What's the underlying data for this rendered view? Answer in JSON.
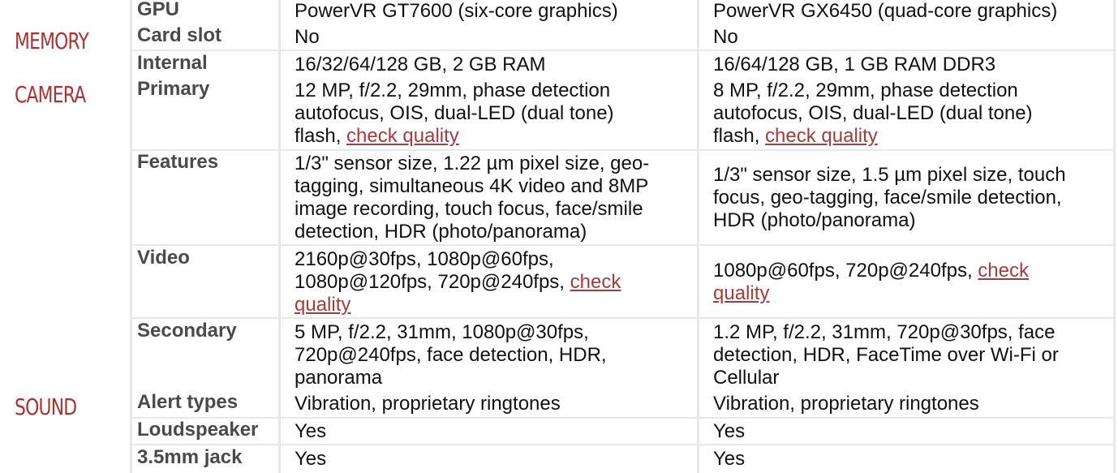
{
  "sections": {
    "memory": "MEMORY",
    "camera": "CAMERA",
    "sound": "SOUND"
  },
  "rows": {
    "gpu": {
      "label": "GPU",
      "left": "PowerVR GT7600 (six-core graphics)",
      "right": "PowerVR GX6450 (quad-core graphics)"
    },
    "card_slot": {
      "label": "Card slot",
      "left": "No",
      "right": "No"
    },
    "internal": {
      "label": "Internal",
      "left": "16/32/64/128 GB, 2 GB RAM",
      "right": "16/64/128 GB, 1 GB RAM DDR3"
    },
    "primary": {
      "label": "Primary",
      "left_lines": [
        "12 MP, f/2.2, 29mm, phase detection",
        "autofocus, OIS, dual-LED (dual tone)",
        "flash, "
      ],
      "left_link": "check quality",
      "right_lines": [
        "8 MP, f/2.2, 29mm, phase detection",
        "autofocus, OIS, dual-LED (dual tone)",
        "flash, "
      ],
      "right_link": "check quality"
    },
    "features": {
      "label": "Features",
      "left_lines": [
        "1/3\" sensor size, 1.22 µm pixel size, geo-",
        "tagging, simultaneous 4K video and 8MP",
        "image recording, touch focus, face/smile",
        "detection, HDR (photo/panorama)"
      ],
      "right_lines": [
        "1/3\" sensor size, 1.5 µm pixel size, touch",
        "focus, geo-tagging, face/smile detection,",
        "HDR (photo/panorama)"
      ]
    },
    "video": {
      "label": "Video",
      "left_lines": [
        "2160p@30fps, 1080p@60fps,",
        "1080p@120fps, 720p@240fps, "
      ],
      "left_link_1": "check",
      "left_link_2": "quality",
      "right_lines": [
        "1080p@60fps, 720p@240fps, "
      ],
      "right_link_1": "check",
      "right_link_2": "quality"
    },
    "secondary": {
      "label": "Secondary",
      "left_lines": [
        "5 MP, f/2.2, 31mm, 1080p@30fps,",
        "720p@240fps, face detection, HDR,",
        "panorama"
      ],
      "right_lines": [
        "1.2 MP, f/2.2, 31mm, 720p@30fps, face",
        "detection, HDR, FaceTime over Wi-Fi or",
        "Cellular"
      ]
    },
    "alert_types": {
      "label": "Alert types",
      "left": "Vibration, proprietary ringtones",
      "right": "Vibration, proprietary ringtones"
    },
    "loudspeaker": {
      "label": "Loudspeaker",
      "left": "Yes",
      "right": "Yes"
    },
    "jack": {
      "label": "3.5mm jack",
      "left": "Yes",
      "right": "Yes"
    }
  }
}
